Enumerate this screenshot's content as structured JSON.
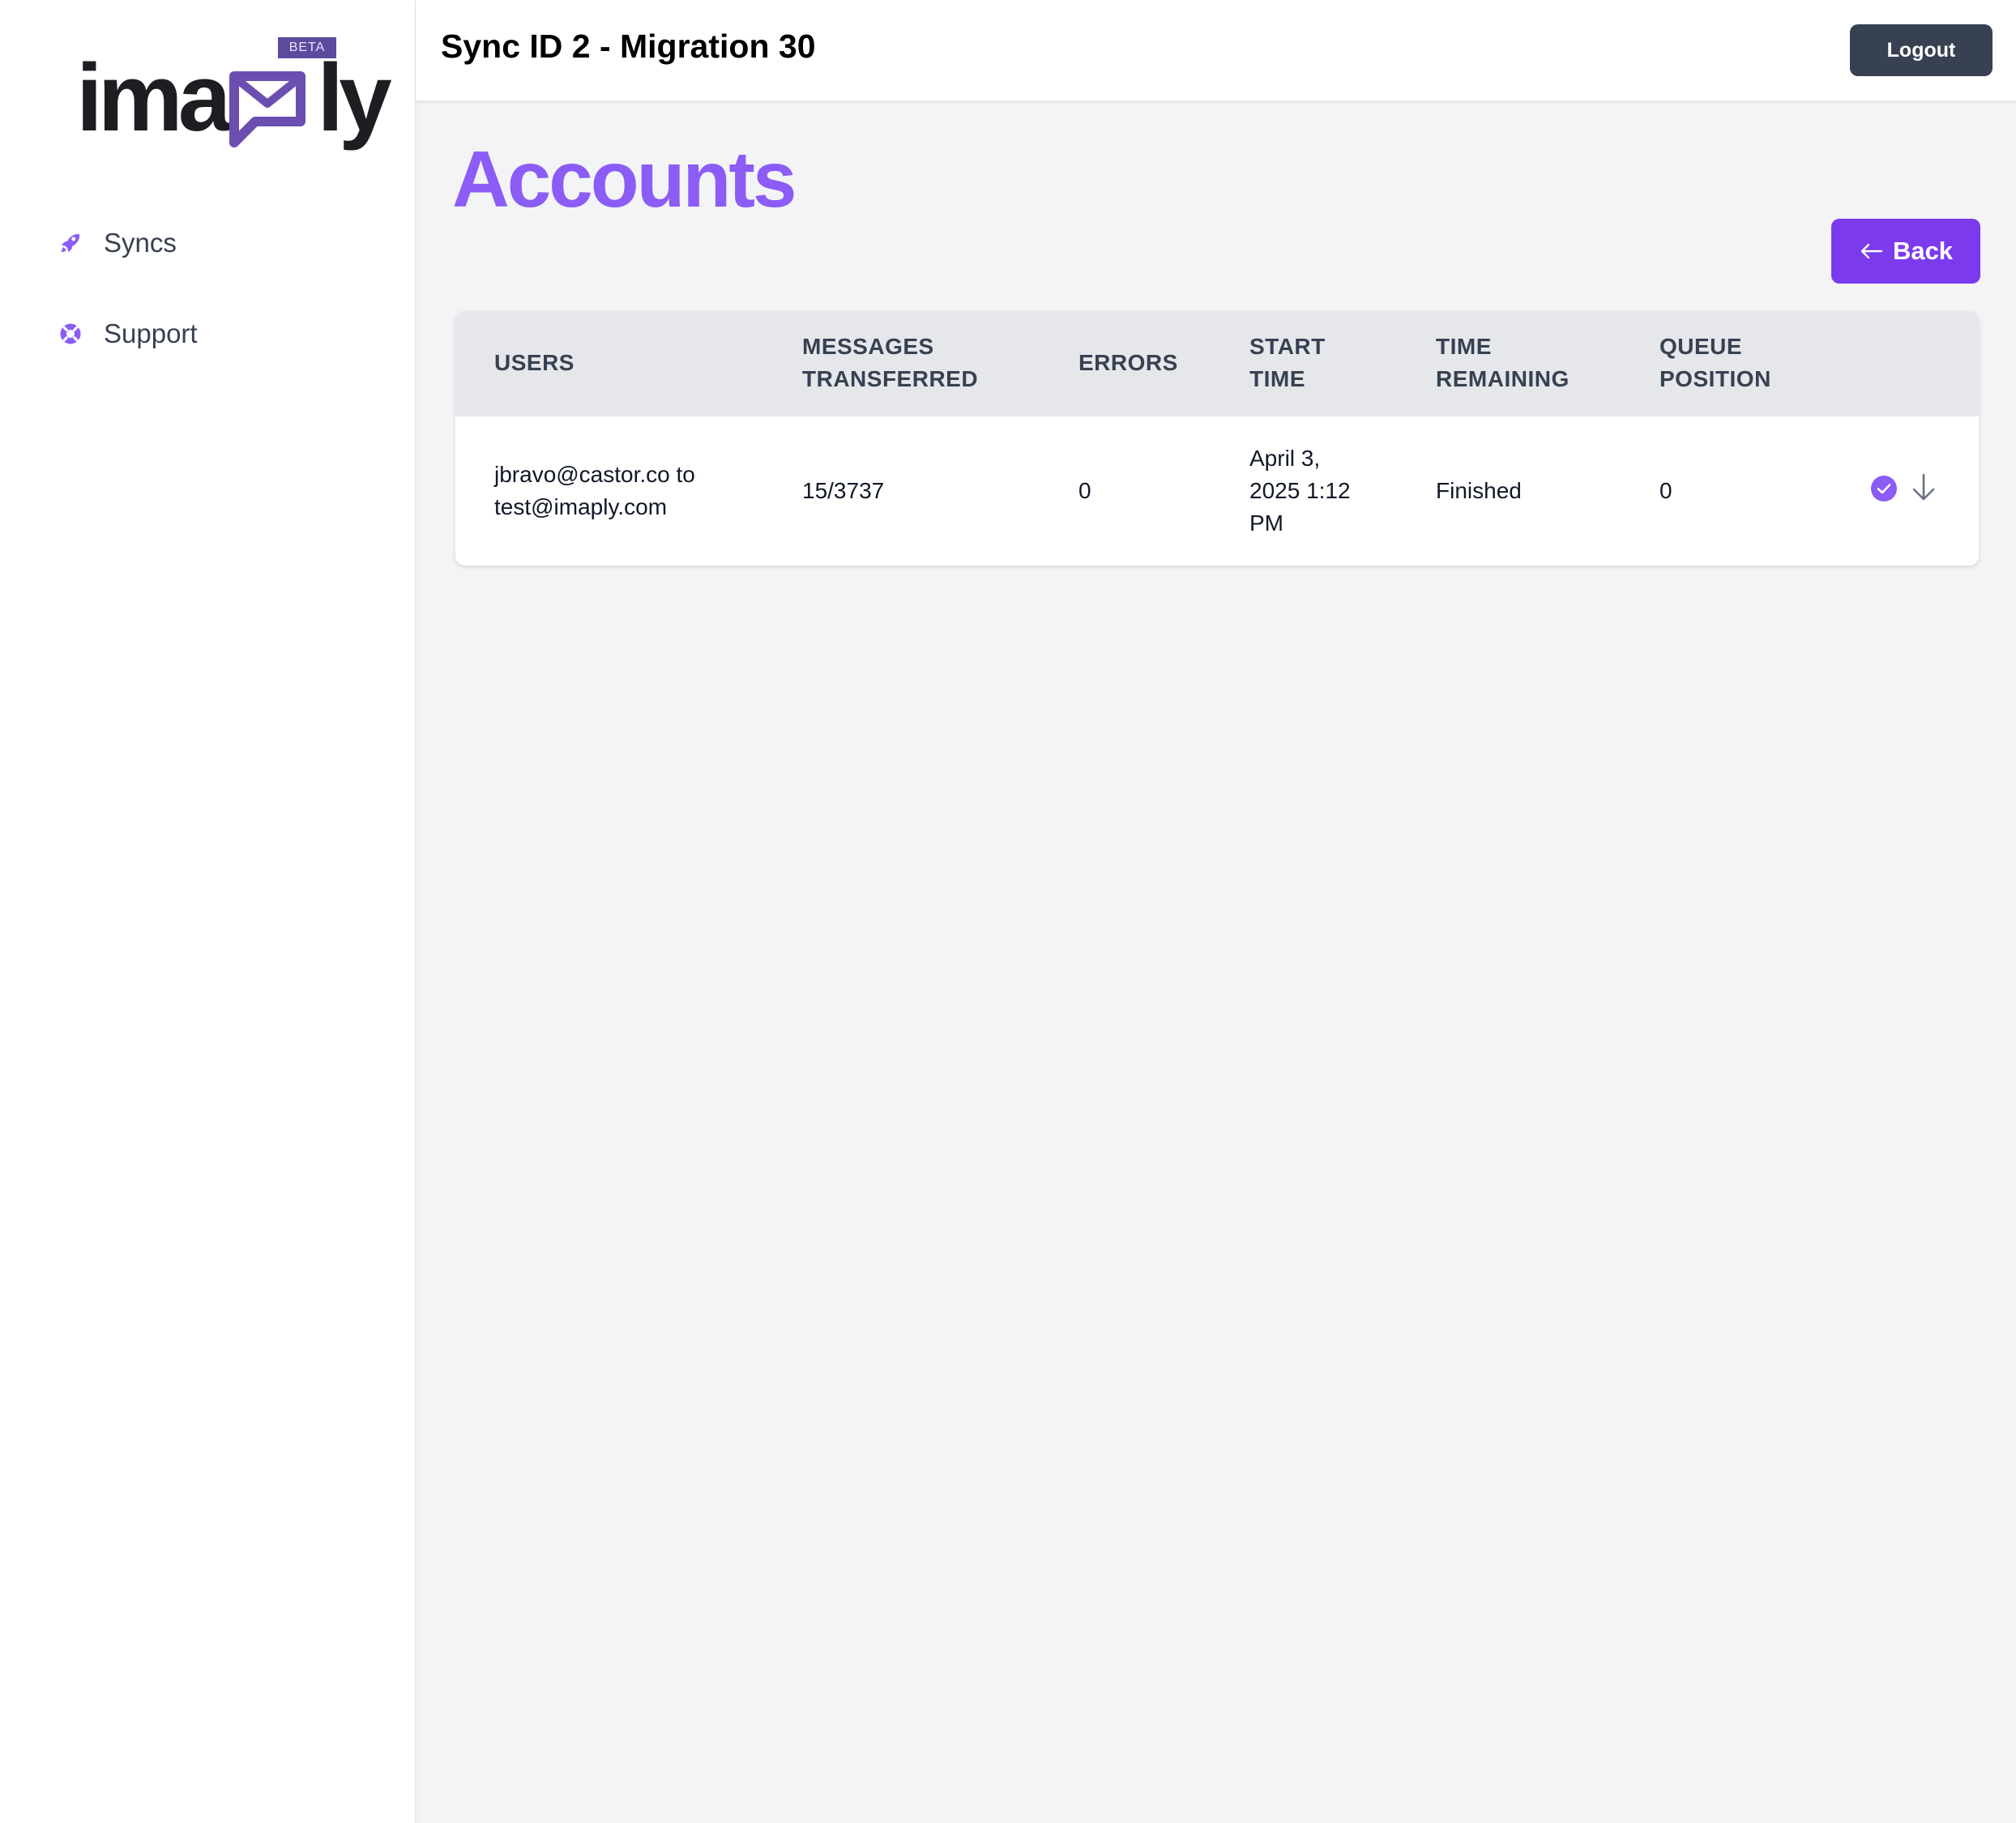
{
  "brand": {
    "name": "imaply",
    "badge": "BETA",
    "color_primary": "#1f1d22",
    "color_accent": "#6b4fb0"
  },
  "sidebar": {
    "items": [
      {
        "label": "Syncs",
        "icon": "rocket-icon"
      },
      {
        "label": "Support",
        "icon": "lifebuoy-icon"
      }
    ]
  },
  "header": {
    "title": "Sync ID 2 - Migration 30",
    "logout_label": "Logout"
  },
  "main": {
    "title": "Accounts",
    "back_label": "Back",
    "accent_color": "#8b5cf6",
    "button_color": "#7c3aed"
  },
  "table": {
    "columns": [
      {
        "line1": "USERS",
        "line2": ""
      },
      {
        "line1": "MESSAGES",
        "line2": "TRANSFERRED"
      },
      {
        "line1": "ERRORS",
        "line2": ""
      },
      {
        "line1": "START",
        "line2": "TIME"
      },
      {
        "line1": "TIME",
        "line2": "REMAINING"
      },
      {
        "line1": "QUEUE",
        "line2": "POSITION"
      }
    ],
    "rows": [
      {
        "users_line1": "jbravo@castor.co to",
        "users_line2": "test@imaply.com",
        "messages": "15/3737",
        "errors": "0",
        "start_line1": "April 3,",
        "start_line2": "2025 1:12",
        "start_line3": "PM",
        "time_remaining": "Finished",
        "queue_position": "0",
        "status_icon": "check-circle-icon",
        "action_icon": "arrow-down-icon"
      }
    ]
  }
}
